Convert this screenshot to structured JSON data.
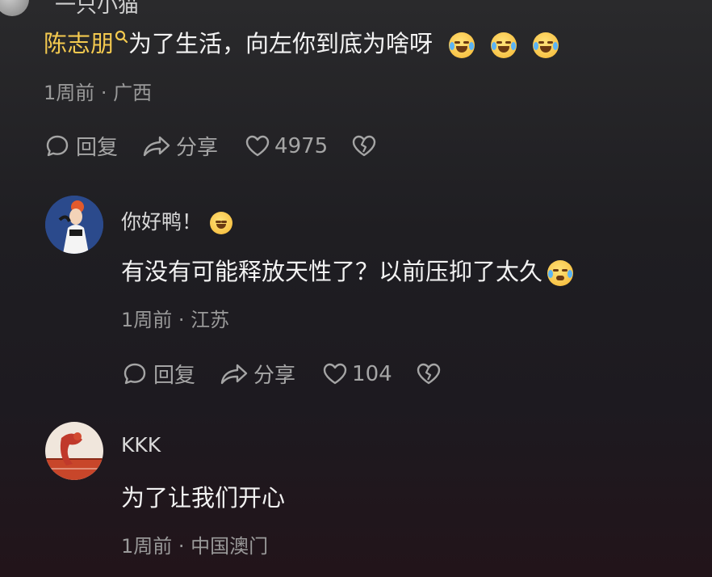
{
  "top_comment": {
    "partial_name": "一只小猫",
    "mention": "陈志朋",
    "text": "为了生活，向左你到底为啥呀",
    "emojis": [
      "laughing-tears-emoji",
      "laughing-tears-emoji",
      "laughing-tears-emoji"
    ],
    "time": "1周前",
    "location": "广西",
    "reply_label": "回复",
    "share_label": "分享",
    "likes": "4975"
  },
  "replies": [
    {
      "username": "你好鸭！",
      "name_emoji": "drooling-face-emoji",
      "text": "有没有可能释放天性了？以前压抑了太久",
      "text_emoji": "pleading-tears-emoji",
      "time": "1周前",
      "location": "江苏",
      "reply_label": "回复",
      "share_label": "分享",
      "likes": "104"
    },
    {
      "username": "KKK",
      "text": "为了让我们开心",
      "time": "1周前",
      "location": "中国澳门"
    }
  ],
  "colors": {
    "mention": "#f3c94f",
    "meta": "#9a9a9a",
    "text": "#f2f2f2"
  }
}
